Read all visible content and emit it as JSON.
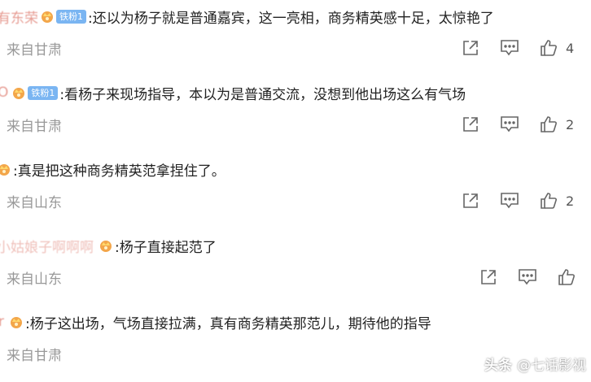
{
  "comments": [
    {
      "username": "有东荣",
      "badge": "铁粉1",
      "text": ":还以为杨子就是普通嘉宾，这一亮相，商务精英感十足，太惊艳了",
      "location": "来自甘肃",
      "likes": "4"
    },
    {
      "username": "O",
      "badge": "铁粉1",
      "text": ":看杨子来现场指导，本以为是普通交流，没想到他出场这么有气场",
      "location": "来自甘肃",
      "likes": "2"
    },
    {
      "username": "",
      "badge": "",
      "text": ":真是把这种商务精英范拿捏住了。",
      "location": "来自山东",
      "likes": "2"
    },
    {
      "username": "小姑娘子啊啊啊",
      "badge": "",
      "text": ":杨子直接起范了",
      "location": "来自山东",
      "likes": ""
    },
    {
      "username": "r",
      "badge": "",
      "text": ":杨子这出场，气场直接拉满，真有商务精英那范儿，期待他的指导",
      "location": "来自甘肃",
      "likes": ""
    }
  ],
  "watermark": {
    "platform": "头条",
    "account": "@七话影视"
  },
  "icons": {
    "share": "share-icon",
    "reply": "comment-icon",
    "like": "thumbs-up-icon"
  },
  "colors": {
    "username": "#d24b3a",
    "badge": "#7ab5f2",
    "location": "#999999",
    "icon": "#666666"
  }
}
